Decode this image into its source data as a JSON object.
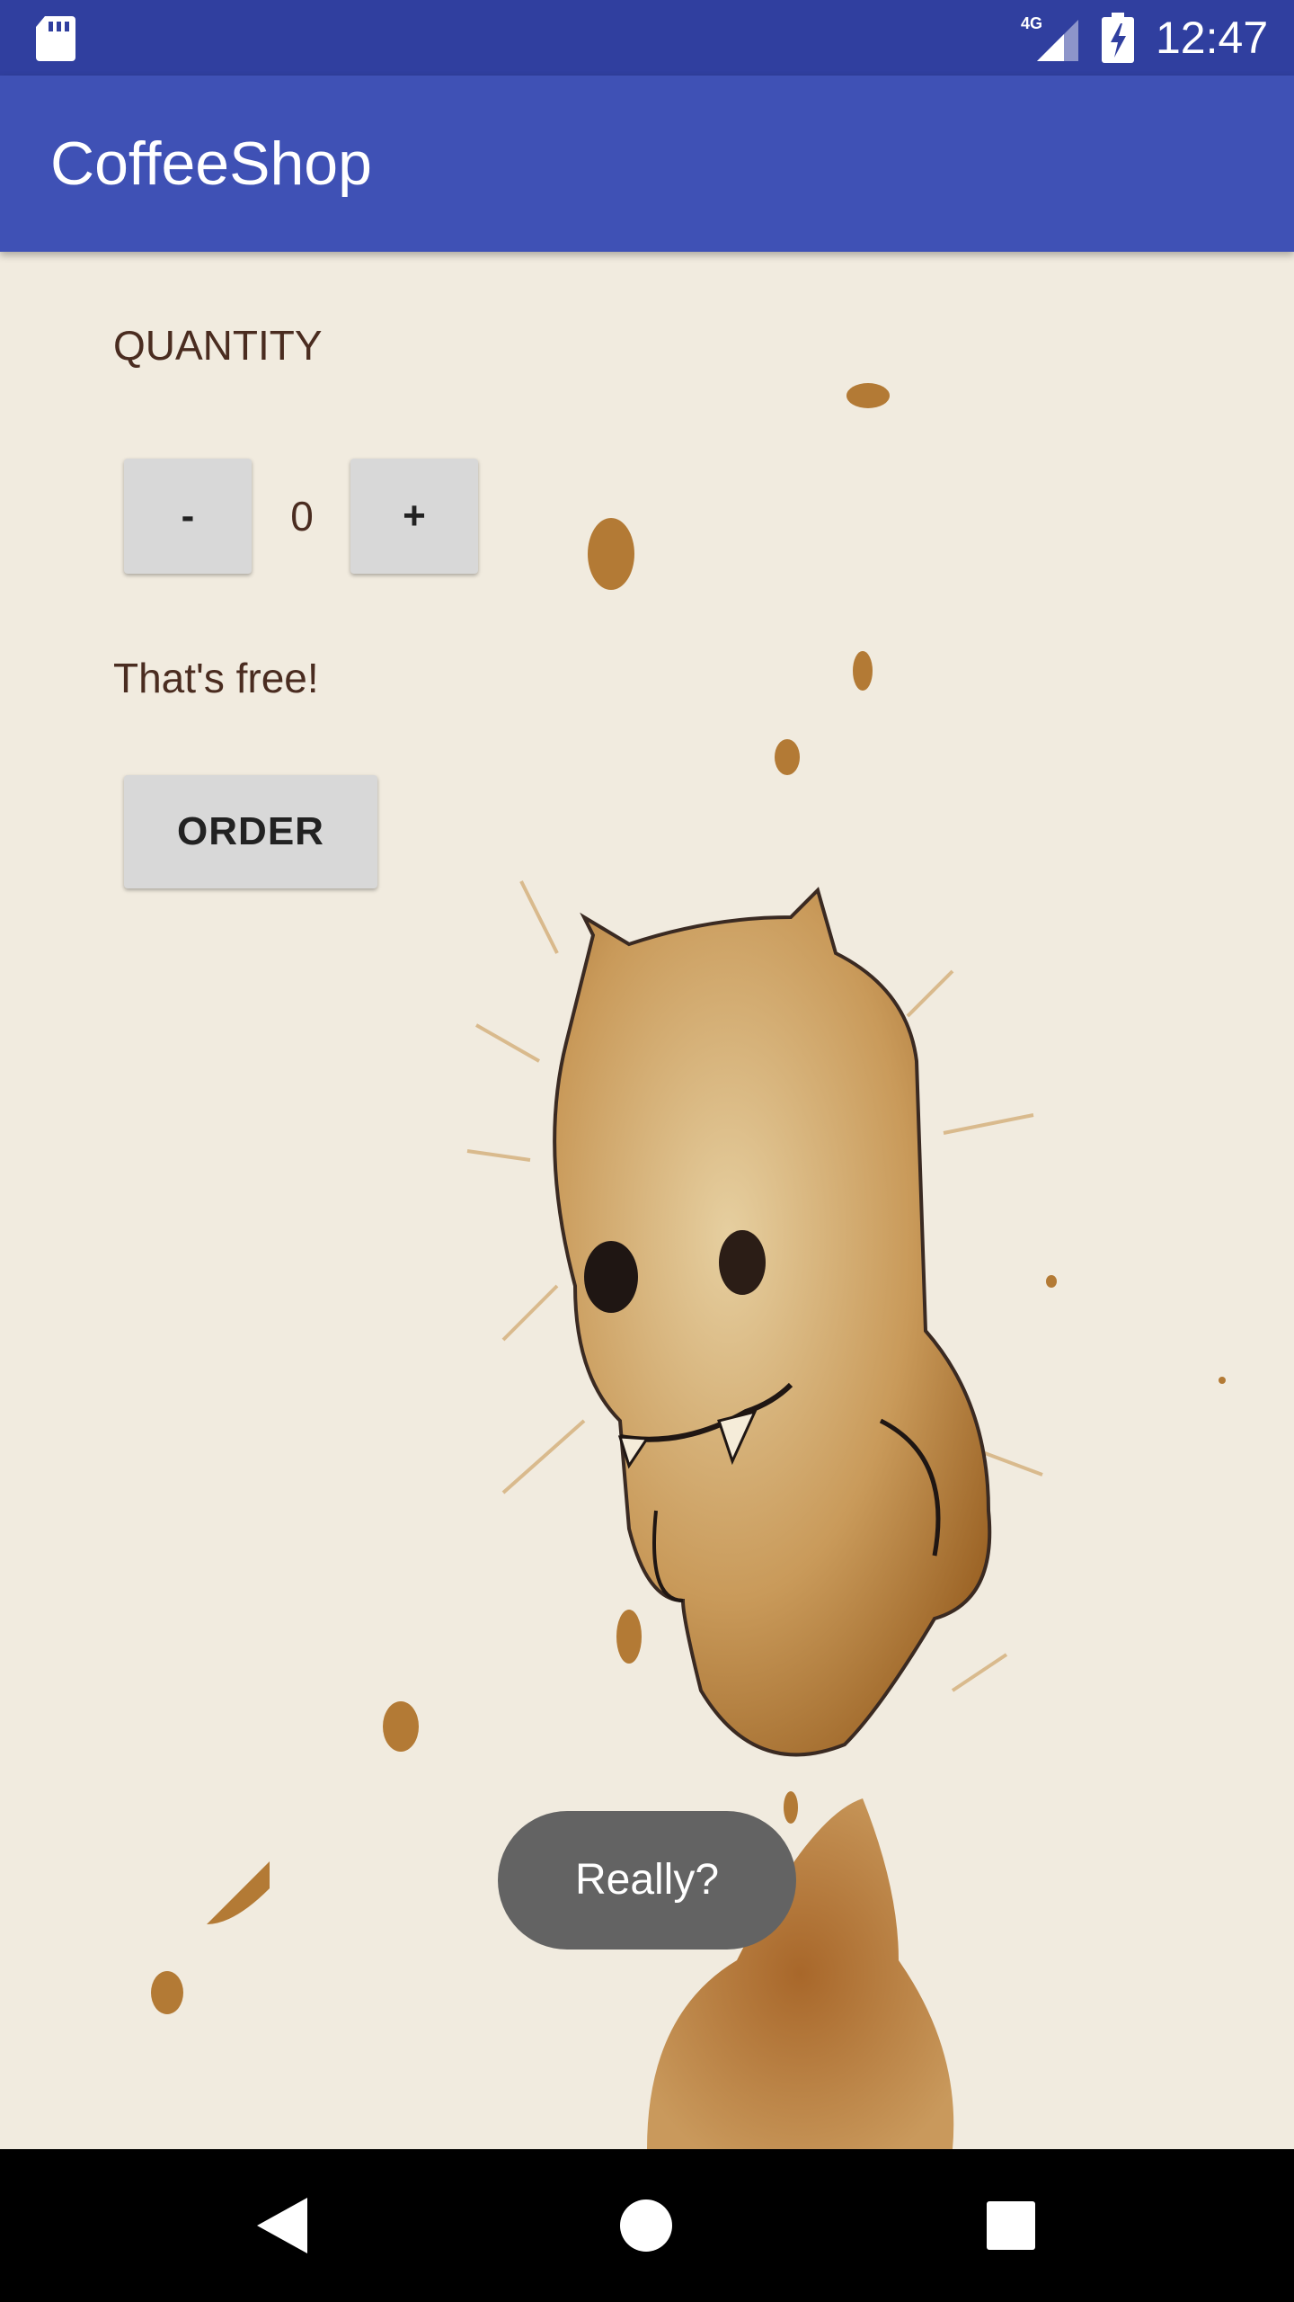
{
  "status_bar": {
    "time": "12:47",
    "network": "4G",
    "icons": [
      "sd-card-icon",
      "cell-signal-icon",
      "battery-charging-icon"
    ]
  },
  "app_bar": {
    "title": "CoffeeShop"
  },
  "content": {
    "quantity_header": "QUANTITY",
    "decrement_label": "-",
    "quantity_value": "0",
    "increment_label": "+",
    "price_summary": "That's free!",
    "order_label": "ORDER",
    "background_image": "coffee-stain-creature-illustration"
  },
  "toast": {
    "message": "Really?"
  },
  "nav_bar": {
    "icons": [
      "back-icon",
      "home-icon",
      "overview-icon"
    ]
  },
  "colors": {
    "status_bar": "#303f9f",
    "app_bar": "#3f51b5",
    "background": "#f1ebdf",
    "text": "#4a2c20",
    "button": "#d8d8d8",
    "toast": "#636363"
  }
}
